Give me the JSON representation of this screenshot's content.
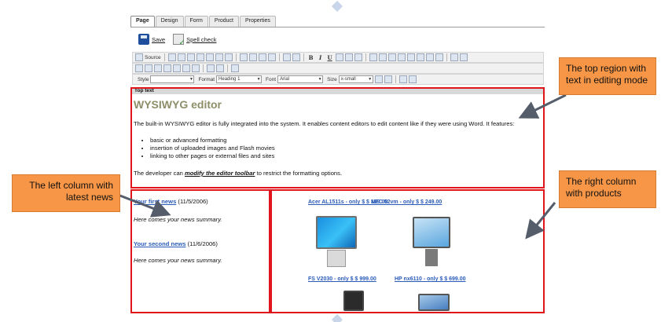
{
  "tabs": [
    "Page",
    "Design",
    "Form",
    "Product",
    "Properties"
  ],
  "savebar": {
    "save_label": "Save",
    "spell_label": "Spell check"
  },
  "toolbar": {
    "source_label": "Source",
    "style_label": "Style",
    "style_value": "",
    "format_label": "Format",
    "format_value": "Heading 1",
    "font_label": "Font",
    "font_value": "Arial",
    "size_label": "Size",
    "size_value": "x-small"
  },
  "top_region": {
    "label": "Top text",
    "heading": "WYSIWYG editor",
    "intro": "The built-in WYSIWYG editor is fully integrated into the system. It enables content editors to edit content like if they were using Word. It features:",
    "bullets": [
      "basic or advanced formatting",
      "insertion of uploaded images and Flash movies",
      "linking to other pages or external files and sites"
    ],
    "outro_prefix": "The developer can ",
    "outro_link": "modify the editor toolbar",
    "outro_suffix": " to restrict the formatting options."
  },
  "news": [
    {
      "title": "Your first news",
      "date": "(11/5/2006)",
      "summary": "Here comes your news summary."
    },
    {
      "title": "Your second news",
      "date": "(11/6/2006)",
      "summary": "Here comes your news summary."
    }
  ],
  "products": [
    "Acer AL1511s - only $ $ 199.00",
    "NEC 52vm - only $ $ 249.00",
    "FS V2030 - only $ $ 999.00",
    "HP nx6110 - only $ $ 699.00"
  ],
  "callouts": {
    "top": "The top region with text in editing mode",
    "left": "The left column with latest news",
    "right": "The right column with products"
  },
  "colors": {
    "region_border": "#e0141b",
    "callout_fill": "#f79646",
    "link": "#2a5bb8",
    "heading": "#8e8e6a",
    "arrow": "#555d6b"
  }
}
